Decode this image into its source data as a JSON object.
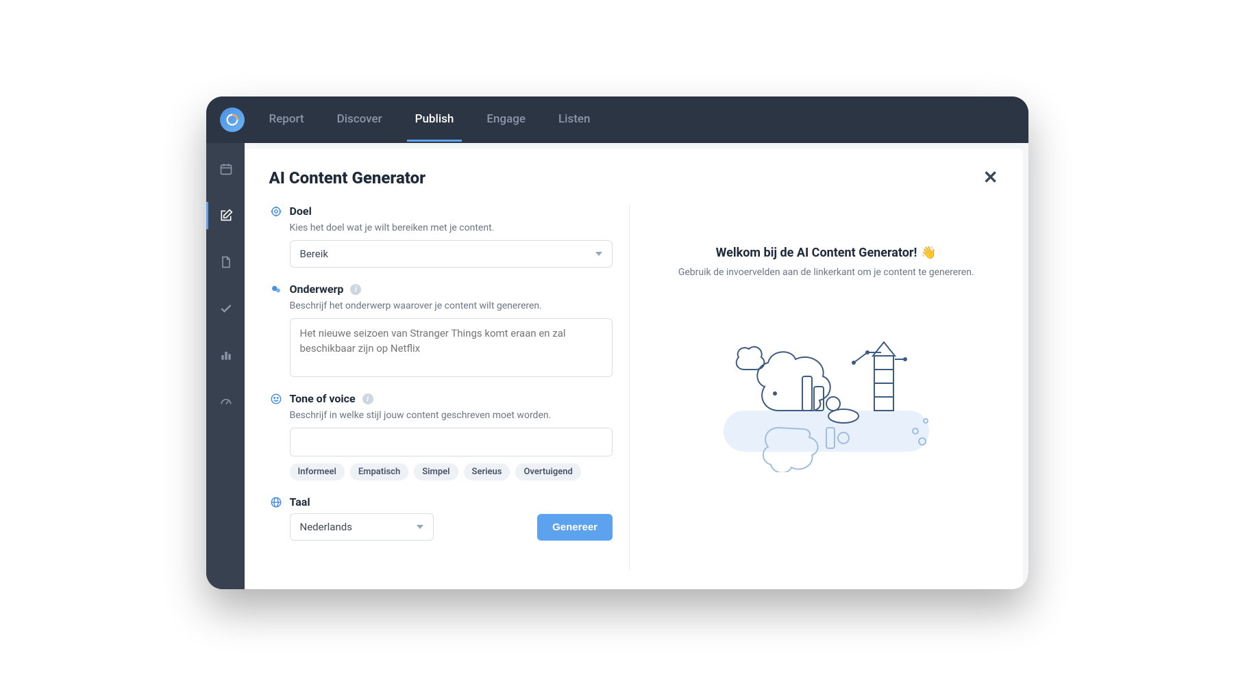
{
  "nav": {
    "items": [
      "Report",
      "Discover",
      "Publish",
      "Engage",
      "Listen"
    ],
    "active_index": 2
  },
  "rail": {
    "items": [
      "calendar",
      "compose",
      "page",
      "check",
      "bars",
      "gauge"
    ],
    "active_index": 1
  },
  "card": {
    "title": "AI Content Generator"
  },
  "sections": {
    "doel": {
      "title": "Doel",
      "desc": "Kies het doel wat je wilt bereiken met je content.",
      "value": "Bereik"
    },
    "onderwerp": {
      "title": "Onderwerp",
      "desc": "Beschrijf het onderwerp waarover je content wilt genereren.",
      "placeholder": "Het nieuwe seizoen van Stranger Things komt eraan en zal beschikbaar zijn op Netflix"
    },
    "tone": {
      "title": "Tone of voice",
      "desc": "Beschrijf in welke stijl jouw content geschreven moet worden.",
      "tags": [
        "Informeel",
        "Empatisch",
        "Simpel",
        "Serieus",
        "Overtuigend"
      ]
    },
    "taal": {
      "title": "Taal",
      "value": "Nederlands"
    }
  },
  "generate_button": "Genereer",
  "welcome": {
    "title": "Welkom bij de AI Content Generator!",
    "emoji": "👋",
    "desc": "Gebruik de invoervelden aan de linkerkant om je content te genereren."
  }
}
